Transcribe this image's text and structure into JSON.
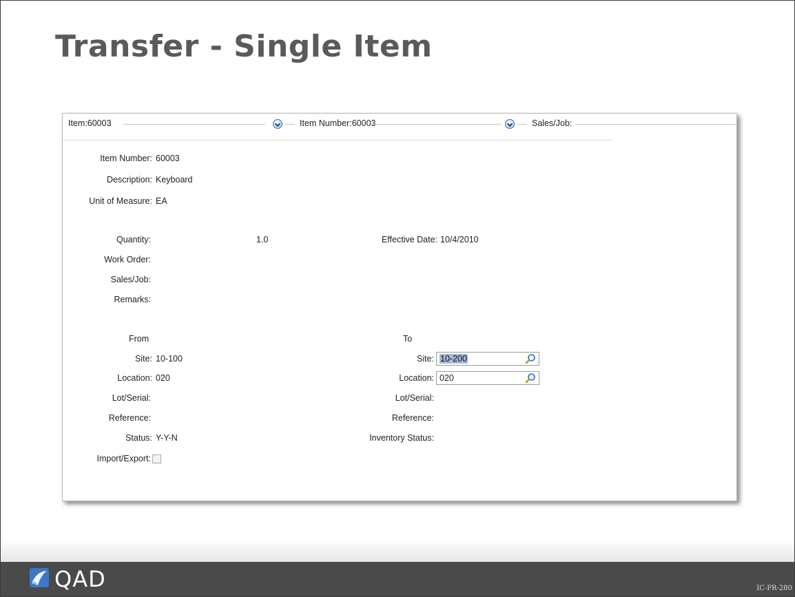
{
  "slide": {
    "title": "Transfer - Single Item",
    "doc_code": "IC-PR-280",
    "logo_text": "QAD"
  },
  "header": {
    "item": "Item:60003",
    "item_number": "Item Number:60003",
    "sales_job": "Sales/Job:"
  },
  "item_info": {
    "item_number_label": "Item Number:",
    "item_number_value": "60003",
    "description_label": "Description:",
    "description_value": "Keyboard",
    "uom_label": "Unit of Measure:",
    "uom_value": "EA"
  },
  "details": {
    "quantity_label": "Quantity:",
    "quantity_value": "1.0",
    "effective_date_label": "Effective Date:",
    "effective_date_value": "10/4/2010",
    "work_order_label": "Work Order:",
    "sales_job_label": "Sales/Job:",
    "remarks_label": "Remarks:"
  },
  "from": {
    "heading": "From",
    "site_label": "Site:",
    "site_value": "10-100",
    "location_label": "Location:",
    "location_value": "020",
    "lot_serial_label": "Lot/Serial:",
    "reference_label": "Reference:",
    "status_label": "Status:",
    "status_value": "Y-Y-N",
    "import_export_label": "Import/Export:"
  },
  "to": {
    "heading": "To",
    "site_label": "Site:",
    "site_value": "10-200",
    "location_label": "Location:",
    "location_value": "020",
    "lot_serial_label": "Lot/Serial:",
    "reference_label": "Reference:",
    "inventory_status_label": "Inventory Status:"
  },
  "colors": {
    "title": "#5a5a5a",
    "footer_bar": "#4a4a4a",
    "logo_blue": "#3e78c4",
    "selection": "#a6b8d6"
  },
  "icons": [
    "chevron-down-icon",
    "search-icon",
    "qad-logo-icon"
  ]
}
